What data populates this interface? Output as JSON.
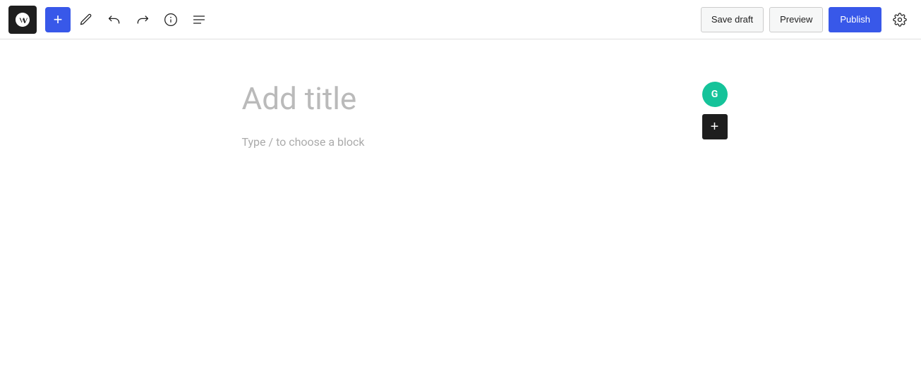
{
  "toolbar": {
    "add_label": "+",
    "save_draft_label": "Save draft",
    "preview_label": "Preview",
    "publish_label": "Publish"
  },
  "editor": {
    "title_placeholder": "Add title",
    "block_placeholder": "Type / to choose a block"
  },
  "icons": {
    "wp_logo": "wordpress-icon",
    "add": "plus-icon",
    "pen": "pen-icon",
    "undo": "undo-icon",
    "redo": "redo-icon",
    "info": "info-icon",
    "list_view": "list-view-icon",
    "settings": "settings-icon",
    "grammarly": "grammarly-icon",
    "block_add": "block-add-icon"
  }
}
